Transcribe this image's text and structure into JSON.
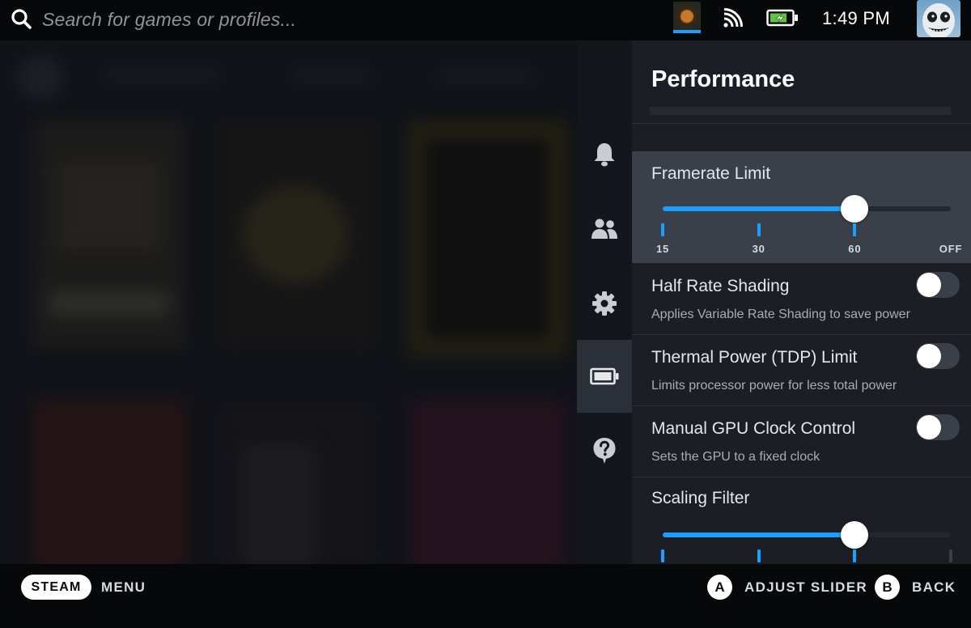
{
  "search": {
    "placeholder": "Search for games or profiles..."
  },
  "status": {
    "clock": "1:49 PM",
    "wifi_icon": "wifi-icon",
    "battery_icon": "battery-charging-icon",
    "battery_level": 0.8
  },
  "sidebar": {
    "items": [
      {
        "name": "notifications",
        "icon": "bell-icon"
      },
      {
        "name": "friends",
        "icon": "friends-icon"
      },
      {
        "name": "settings",
        "icon": "gear-icon"
      },
      {
        "name": "performance",
        "icon": "battery-icon",
        "active": true
      },
      {
        "name": "help",
        "icon": "help-icon"
      }
    ]
  },
  "panel": {
    "title": "Performance",
    "framerate": {
      "label": "Framerate Limit",
      "ticks": [
        "15",
        "30",
        "60",
        "OFF"
      ],
      "selected": "60"
    },
    "half_rate_shading": {
      "label": "Half Rate Shading",
      "description": "Applies Variable Rate Shading to save power",
      "enabled": false
    },
    "tdp_limit": {
      "label": "Thermal Power (TDP) Limit",
      "description": "Limits processor power for less total power",
      "enabled": false
    },
    "gpu_clock": {
      "label": "Manual GPU Clock Control",
      "description": "Sets the GPU to a fixed clock",
      "enabled": false
    },
    "scaling_filter": {
      "label": "Scaling Filter",
      "selected_index": 2,
      "tick_count": 4
    }
  },
  "footer": {
    "steam_label": "STEAM",
    "menu_label": "MENU",
    "a_button": "A",
    "a_action": "ADJUST SLIDER",
    "b_button": "B",
    "b_action": "BACK"
  },
  "colors": {
    "accent": "#1a9fff",
    "panel_bg": "#1b1f25",
    "focus_bg": "#3a4049",
    "footer_bg": "#07080a"
  }
}
